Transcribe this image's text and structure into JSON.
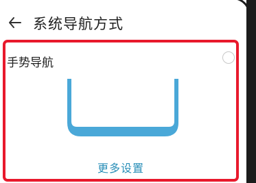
{
  "header": {
    "back_icon": "back-arrow-icon",
    "title": "系统导航方式"
  },
  "gesture_option": {
    "label": "手势导航",
    "selected": false,
    "illustration": "gesture-navigation-illustration"
  },
  "more_settings_label": "更多设置",
  "colors": {
    "highlight": "#e8192c",
    "accent": "#2a8fb8",
    "illustration": "#4aa8d8"
  }
}
